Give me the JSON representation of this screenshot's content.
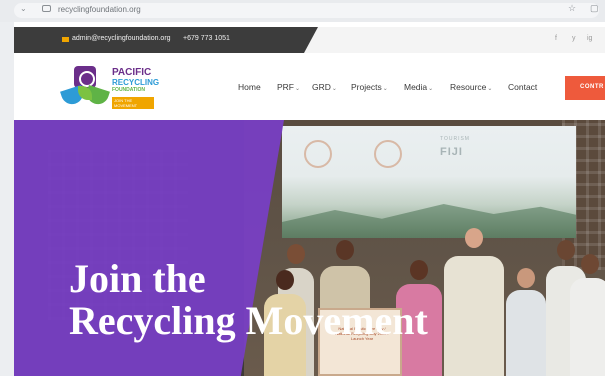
{
  "browser": {
    "url": "recyclingfoundation.org"
  },
  "topbar": {
    "email": "admin@recyclingfoundation.org",
    "phone": "+679 773 1051",
    "social": [
      "facebook-icon",
      "twitter-icon",
      "instagram-icon"
    ],
    "social_glyphs": [
      "f",
      "y",
      "ig"
    ]
  },
  "logo": {
    "line1": "PACIFIC",
    "line2": "RECYCLING",
    "line3": "FOUNDATION",
    "tag": "JOIN THE MOVEMENT"
  },
  "nav": {
    "items": [
      {
        "label": "Home",
        "dropdown": false
      },
      {
        "label": "PRF",
        "dropdown": true
      },
      {
        "label": "GRD",
        "dropdown": true
      },
      {
        "label": "Projects",
        "dropdown": true
      },
      {
        "label": "Media",
        "dropdown": true
      },
      {
        "label": "Resource",
        "dropdown": true
      },
      {
        "label": "Contact",
        "dropdown": false
      }
    ],
    "chevron": "⌄",
    "cta": "CONTR"
  },
  "hero": {
    "title_line1": "Join the",
    "title_line2": "Recycling Movement",
    "screen_text": "TOURISM",
    "screen_text2": "FIJI",
    "placard_text": "National Plastic Free Day / National Recycling Day 2022 / Launch Year",
    "colors": {
      "purple": "#783ec6",
      "cta": "#ee5a3c",
      "brand_purple": "#6b2e8a",
      "brand_blue": "#2d9bd6",
      "brand_green": "#5fb346"
    }
  }
}
